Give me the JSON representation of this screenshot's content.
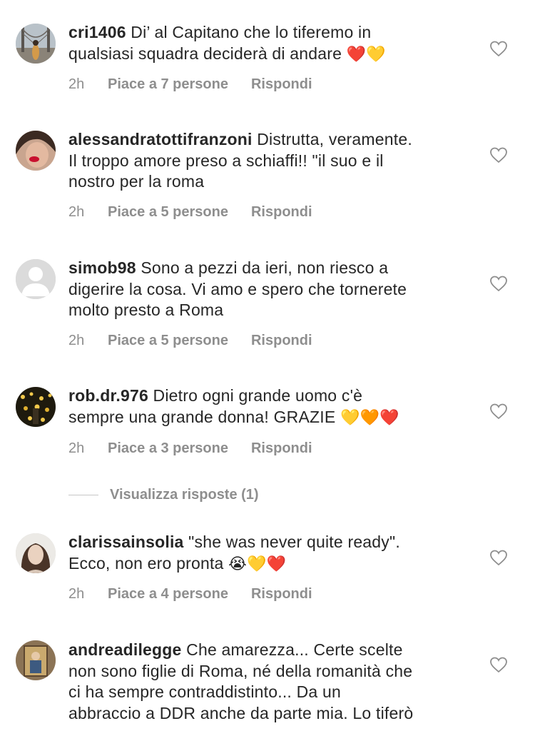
{
  "comments": [
    {
      "username": "cri1406",
      "text_lines": [
        "Di’ al Capitano che lo tiferemo in",
        "qualsiasi squadra deciderà di andare"
      ],
      "emojis": "❤️💛",
      "time": "2h",
      "likes": "Piace a 7 persone",
      "reply": "Rispondi",
      "avatar": "bridge-photo"
    },
    {
      "username": "alessandratottifranzoni",
      "text_lines": [
        "Distrutta, veramente.",
        "Il troppo amore preso a schiaffi!! \"il suo e il",
        "nostro per la roma"
      ],
      "emojis": "",
      "time": "2h",
      "likes": "Piace a 5 persone",
      "reply": "Rispondi",
      "avatar": "woman-red-lips-photo"
    },
    {
      "username": "simob98",
      "text_lines": [
        "Sono a pezzi da ieri, non riesco a",
        "digerire la cosa. Vi amo e spero che tornerete",
        "molto presto a Roma"
      ],
      "emojis": "",
      "time": "2h",
      "likes": "Piace a 5 persone",
      "reply": "Rispondi",
      "avatar": "default-avatar"
    },
    {
      "username": "rob.dr.976",
      "text_lines": [
        "Dietro ogni grande uomo c'è",
        "sempre una grande donna! GRAZIE"
      ],
      "emojis": "💛🧡❤️",
      "time": "2h",
      "likes": "Piace a 3 persone",
      "reply": "Rispondi",
      "avatar": "lights-photo"
    },
    {
      "username": "clarissainsolia",
      "text_lines": [
        "\"she was never quite ready\".",
        "Ecco, non ero pronta"
      ],
      "emojis": "😭💛❤️",
      "time": "2h",
      "likes": "Piace a 4 persone",
      "reply": "Rispondi",
      "avatar": "woman-portrait-photo"
    },
    {
      "username": "andreadilegge",
      "text_lines": [
        "Che amarezza... Certe scelte",
        "non sono figlie di Roma, né della romanità che",
        "ci ha sempre contraddistinto... Da un",
        "abbraccio a DDR anche da parte mia. Lo tiferò"
      ],
      "emojis": "",
      "time": "",
      "likes": "",
      "reply": "",
      "avatar": "painting-photo"
    }
  ],
  "view_replies": "Visualizza risposte (1)",
  "icons": {
    "like": "heart-outline-icon"
  },
  "colors": {
    "text": "#262626",
    "meta": "#8e8e8e",
    "heart_stroke": "#8e8e8e"
  }
}
